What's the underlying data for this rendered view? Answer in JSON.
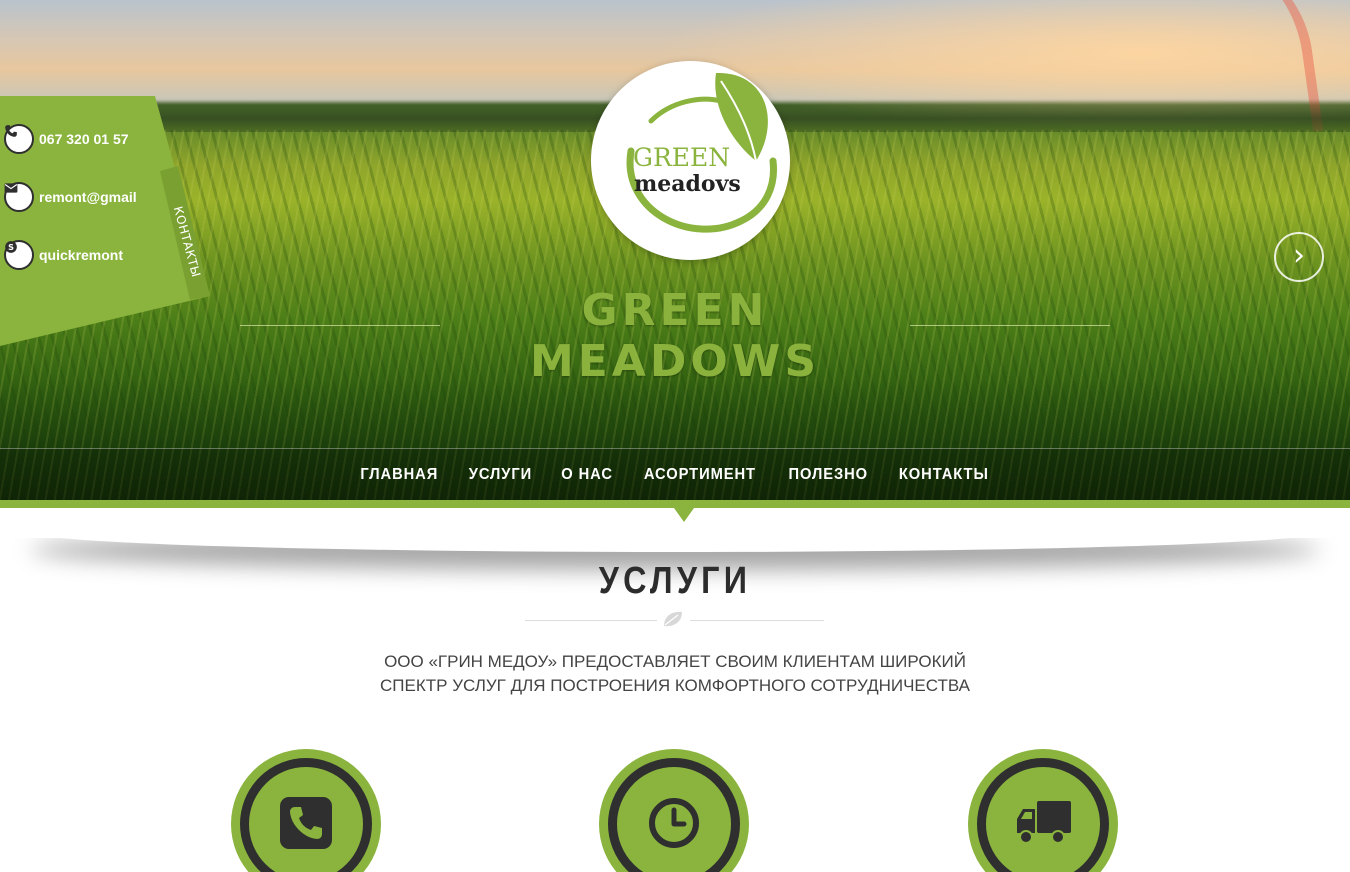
{
  "brand": {
    "logo_word_1": "GREEN",
    "logo_word_2": "meadovs",
    "hero_title": "GREEN MEADOWS",
    "colors": {
      "accent": "#8ab43d",
      "dark": "#2f2f2f"
    }
  },
  "contacts": {
    "phone": "067 320 01 57",
    "email": "remont@gmail",
    "skype": "quickremont",
    "tab_label": "КОНТАКТЫ",
    "icons": [
      "phone-icon",
      "envelope-icon",
      "skype-icon"
    ]
  },
  "nav": {
    "items": [
      {
        "label": "ГЛАВНАЯ"
      },
      {
        "label": "УСЛУГИ"
      },
      {
        "label": "О НАС"
      },
      {
        "label": "АСОРТИМЕНТ"
      },
      {
        "label": "ПОЛЕЗНО"
      },
      {
        "label": "КОНТАКТЫ"
      }
    ]
  },
  "slider": {
    "next_glyph": "›"
  },
  "services": {
    "title": "УСЛУГИ",
    "description_line_1": "ООО «ГРИН МЕДОУ» ПРЕДОСТАВЛЯЕТ СВОИМ КЛИЕНТАМ ШИРОКИЙ",
    "description_line_2": "СПЕКТР УСЛУГ ДЛЯ ПОСТРОЕНИЯ КОМФОРТНОГО СОТРУДНИЧЕСТВА",
    "items": [
      {
        "icon": "phone-icon"
      },
      {
        "icon": "clock-icon"
      },
      {
        "icon": "truck-icon"
      }
    ]
  }
}
